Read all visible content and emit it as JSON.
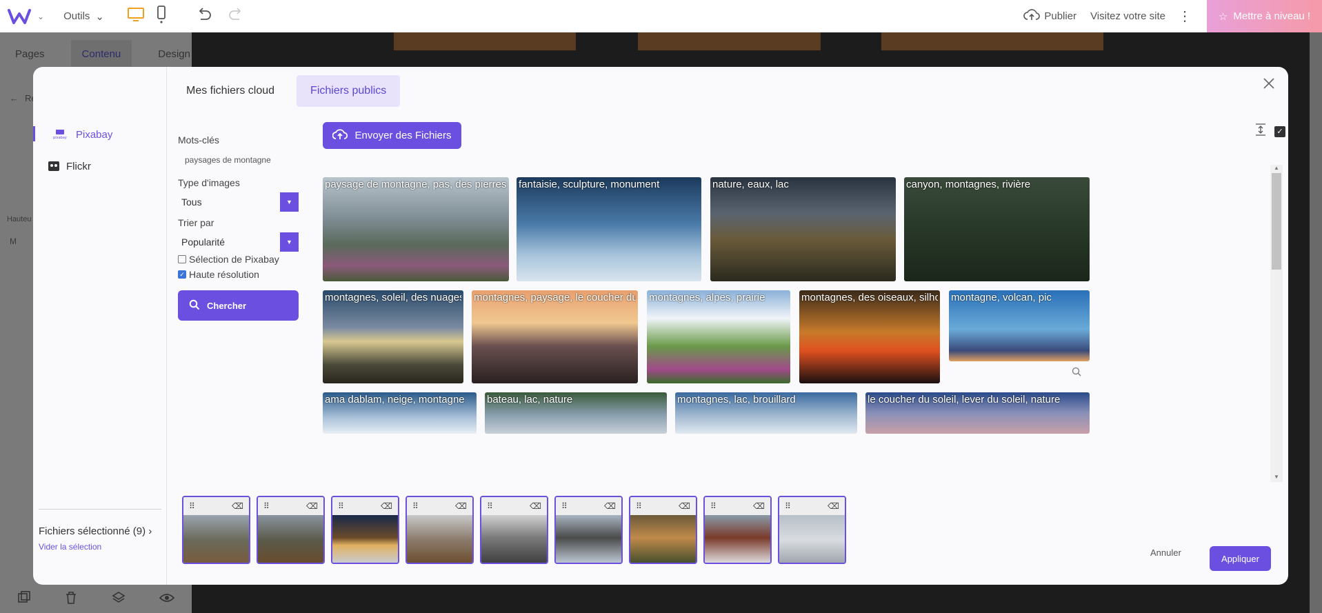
{
  "topbar": {
    "tools_label": "Outils",
    "publish_label": "Publier",
    "visit_label": "Visitez votre site",
    "upgrade_label": "Mettre à niveau !"
  },
  "editor": {
    "tabs": [
      "Pages",
      "Contenu",
      "Design"
    ],
    "ghost_back": "Re",
    "ghost_height": "Hauteu",
    "ghost_size": "M"
  },
  "modal": {
    "tabs": [
      "Mes fichiers cloud",
      "Fichiers publics"
    ],
    "providers": [
      "Pixabay",
      "Flickr"
    ],
    "selection": {
      "count_label": "Fichiers sélectionné (9) ›",
      "clear_label": "Vider la sélection"
    },
    "form": {
      "keywords_label": "Mots-clés",
      "keywords_value": "paysages de montagne",
      "type_label": "Type d'images",
      "type_value": "Tous",
      "sort_label": "Trier par",
      "sort_value": "Popularité",
      "pixabay_selection_label": "Sélection de Pixabay",
      "high_res_label": "Haute résolution",
      "search_label": "Chercher"
    },
    "upload_label": "Envoyer des Fichiers",
    "images": [
      "paysage de montagne, pas, des pierres",
      "fantaisie, sculpture, monument",
      "nature, eaux, lac",
      "canyon, montagnes, rivière",
      "montagnes, soleil, des nuages",
      "montagnes, paysage, le coucher du soleil",
      "montagnes, alpes, prairie",
      "montagnes, des oiseaux, silhouette",
      "montagne, volcan, pic",
      "ama dablam, neige, montagne",
      "bateau, lac, nature",
      "montagnes, lac, brouillard",
      "le coucher du soleil, lever du soleil, nature"
    ],
    "cancel_label": "Annuler",
    "apply_label": "Appliquer"
  },
  "colors": {
    "accent": "#6a4fe0",
    "upgrade_start": "#e9a0d8",
    "upgrade_end": "#f59aa8",
    "device_active": "#f0a020"
  }
}
